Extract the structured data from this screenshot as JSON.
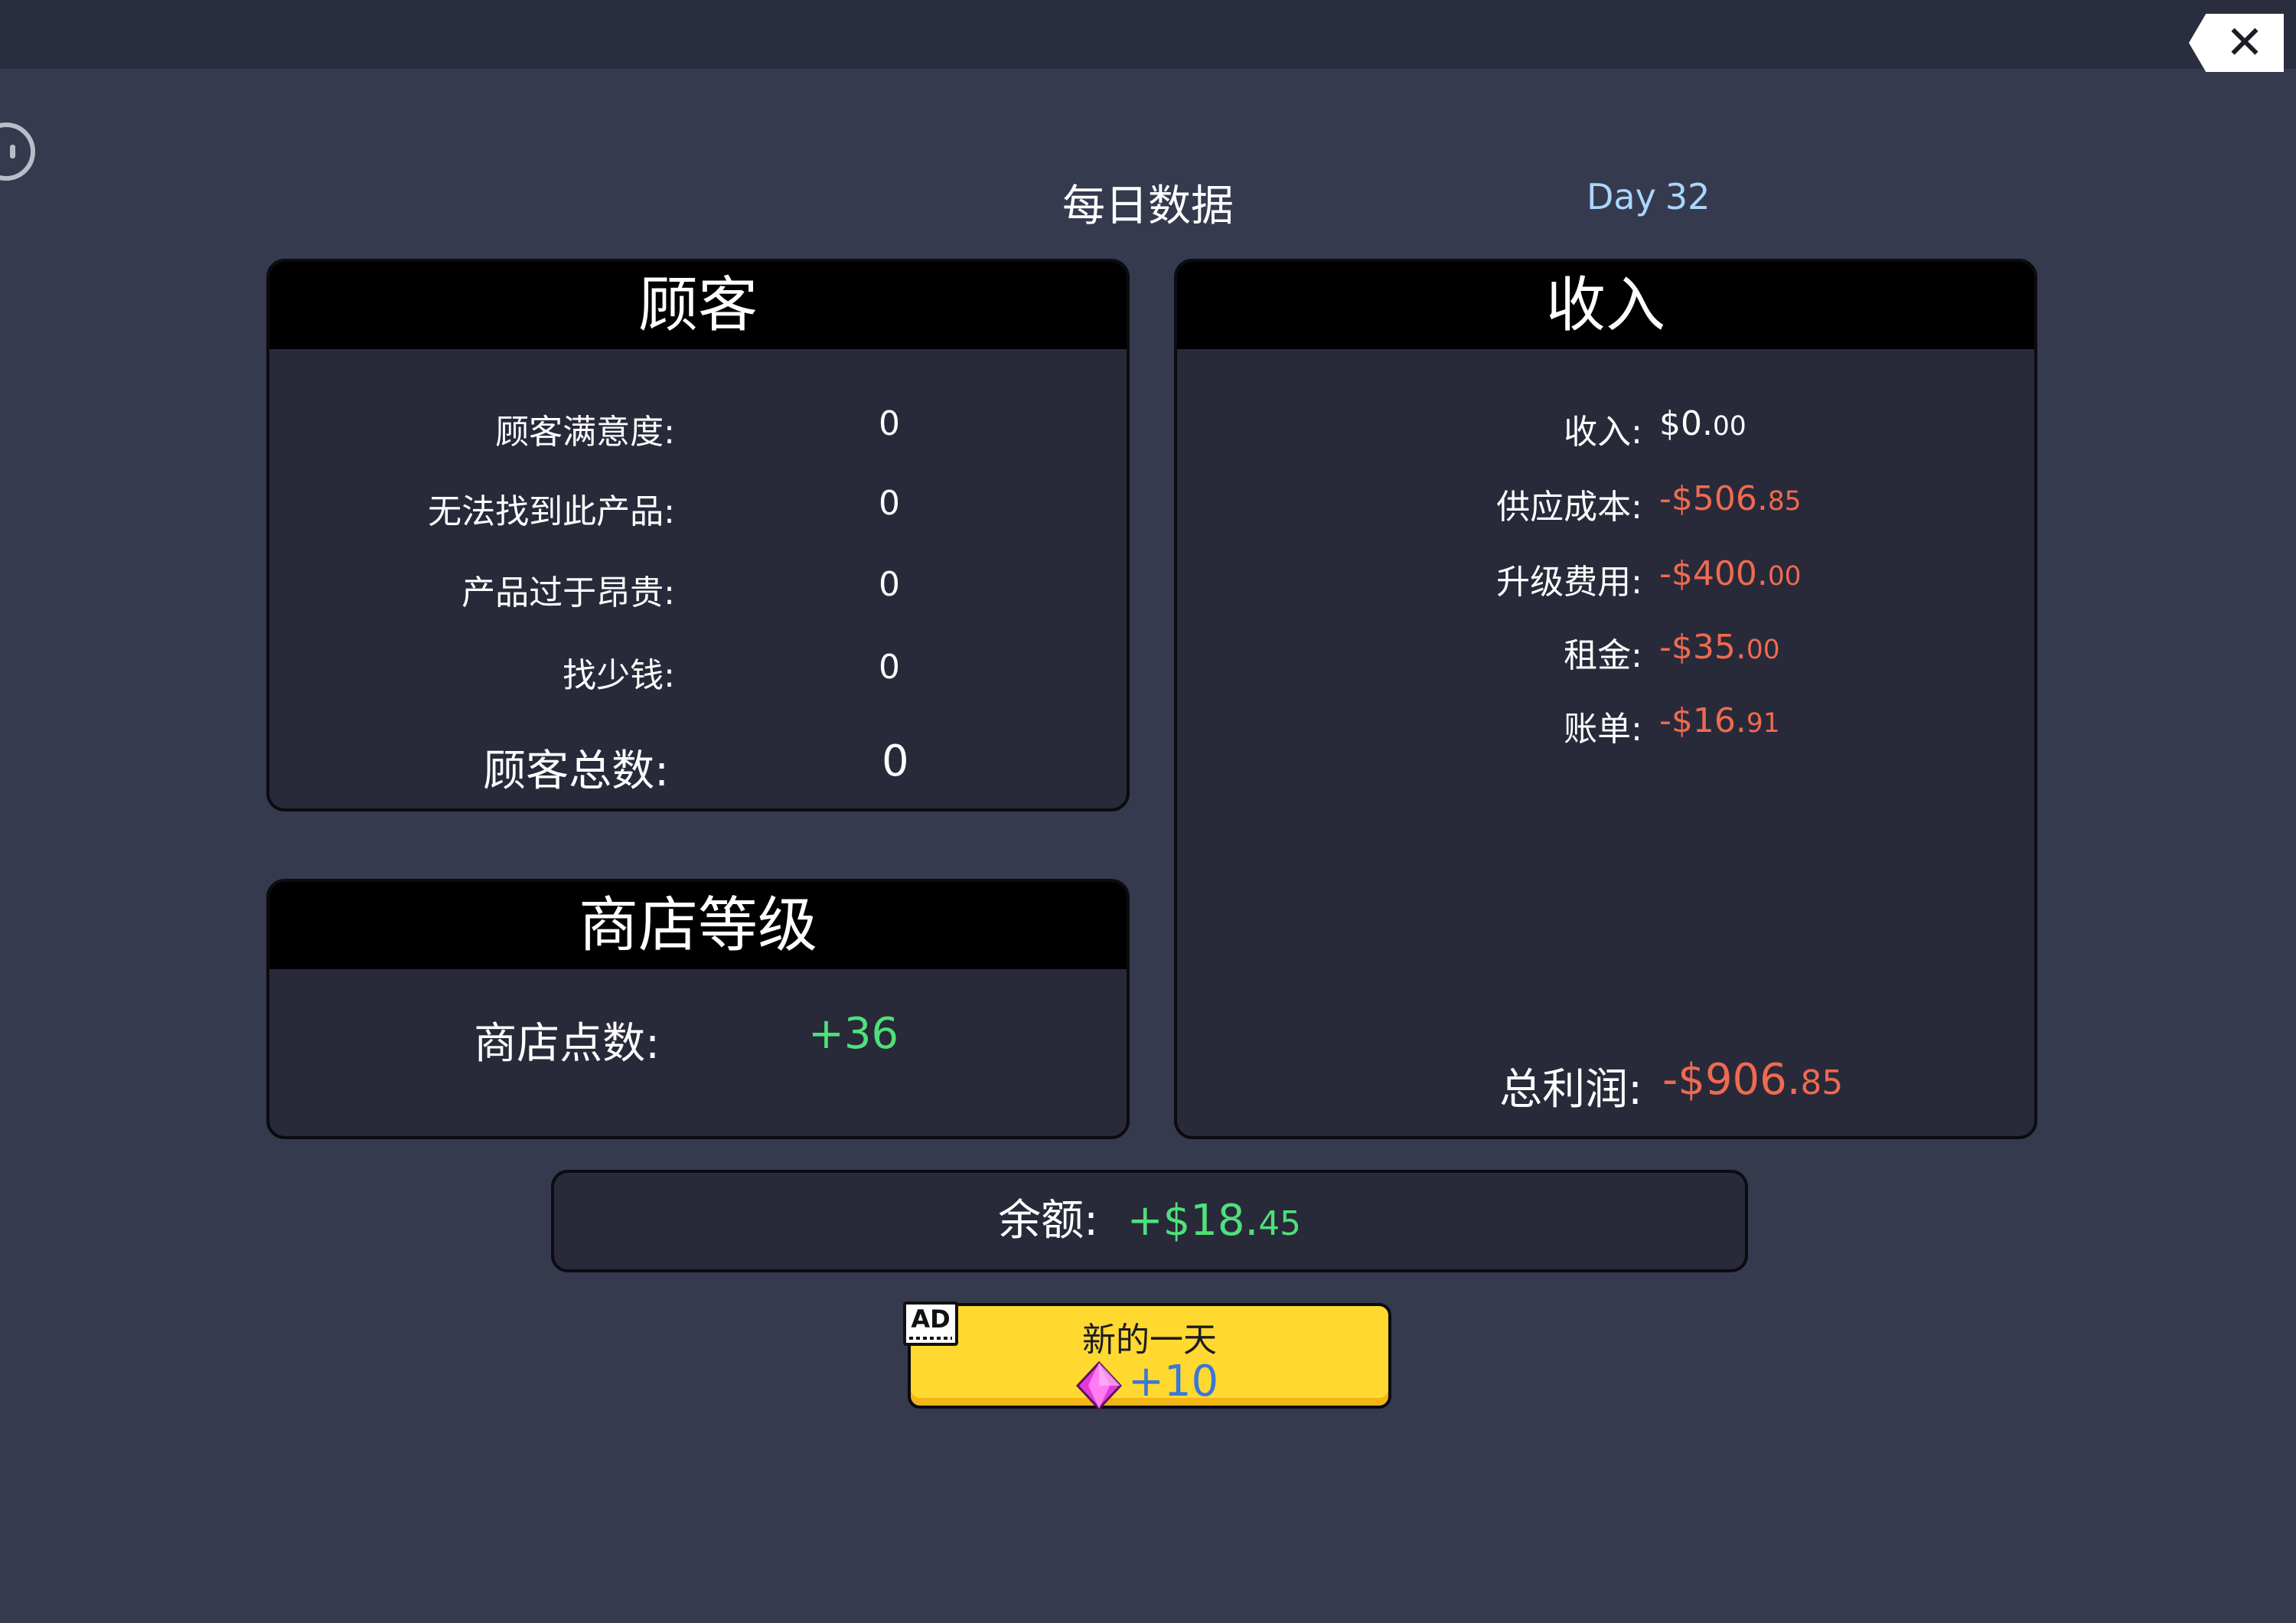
{
  "header": {
    "title": "每日数据",
    "day_label": "Day",
    "day_number": "32"
  },
  "close_icon": "close-icon",
  "customers": {
    "title": "顾客",
    "rows": [
      {
        "label": "顾客满意度:",
        "value": "0"
      },
      {
        "label": "无法找到此产品:",
        "value": "0"
      },
      {
        "label": "产品过于昂贵:",
        "value": "0"
      },
      {
        "label": "找少钱:",
        "value": "0"
      }
    ],
    "total_label": "顾客总数:",
    "total_value": "0"
  },
  "shop_level": {
    "title": "商店等级",
    "points_label": "商店点数:",
    "points_value": "+36"
  },
  "income": {
    "title": "收入",
    "rows": [
      {
        "label": "收入:",
        "main": "$0.",
        "cents": "00",
        "color": "#ffffff"
      },
      {
        "label": "供应成本:",
        "main": "-$506.",
        "cents": "85",
        "color": "#f06a4f"
      },
      {
        "label": "升级费用:",
        "main": "-$400.",
        "cents": "00",
        "color": "#f06a4f"
      },
      {
        "label": "租金:",
        "main": "-$35.",
        "cents": "00",
        "color": "#f06a4f"
      },
      {
        "label": "账单:",
        "main": "-$16.",
        "cents": "91",
        "color": "#f06a4f"
      }
    ],
    "profit_label": "总利润:",
    "profit_main": "-$906.",
    "profit_cents": "85"
  },
  "balance": {
    "label": "余额:",
    "main": "+$18.",
    "cents": "45"
  },
  "new_day_button": {
    "label": "新的一天",
    "reward": "+10",
    "ad_badge": "AD",
    "gem_icon": "gem-icon"
  },
  "colors": {
    "negative": "#f06a4f",
    "positive": "#4fe07a",
    "day": "#a9d7ff",
    "button": "#ffd930"
  }
}
